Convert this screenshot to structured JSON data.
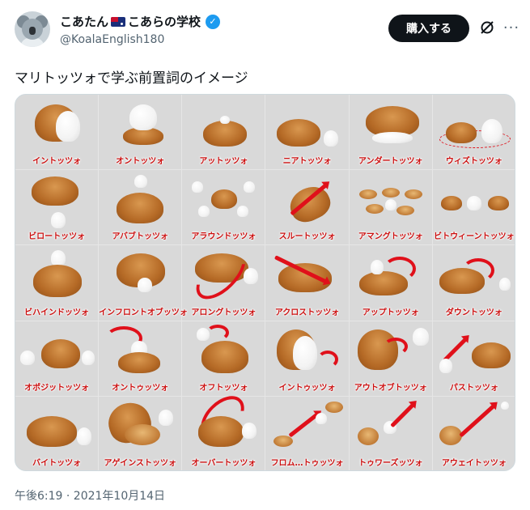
{
  "user": {
    "display_name_pre": "こあたん",
    "display_name_post": "こあらの学校",
    "handle": "@KoalaEnglish180",
    "verified": true,
    "flag_icon": "australia-flag-icon"
  },
  "actions": {
    "buy_label": "購入する",
    "grok_icon": "grok-icon",
    "more_icon": "more-icon"
  },
  "tweet": {
    "text": "マリトッツォで学ぶ前置詞のイメージ",
    "timestamp": "午後6:19 · 2021年10月14日"
  },
  "image": {
    "cells": [
      {
        "label": "イントッツォ"
      },
      {
        "label": "オントッツォ"
      },
      {
        "label": "アットッツォ"
      },
      {
        "label": "ニアトッツォ"
      },
      {
        "label": "アンダートッツォ"
      },
      {
        "label": "ウィズトッツォ"
      },
      {
        "label": "ビロートッツォ"
      },
      {
        "label": "アバブトッツォ"
      },
      {
        "label": "アラウンドッツォ"
      },
      {
        "label": "スルートッツォ"
      },
      {
        "label": "アマングトッツォ"
      },
      {
        "label": "ビトウィーントッツォ"
      },
      {
        "label": "ビハインドッツォ"
      },
      {
        "label": "インフロントオブッツォ"
      },
      {
        "label": "アロングトッツォ"
      },
      {
        "label": "アクロストッツォ"
      },
      {
        "label": "アップトッツォ"
      },
      {
        "label": "ダウントッツォ"
      },
      {
        "label": "オポジットッツォ"
      },
      {
        "label": "オントゥッツォ"
      },
      {
        "label": "オフトッツォ"
      },
      {
        "label": "イントゥッツォ"
      },
      {
        "label": "アウトオブトッツォ"
      },
      {
        "label": "パストッツォ"
      },
      {
        "label": "バイトッツォ"
      },
      {
        "label": "アゲインストッツォ"
      },
      {
        "label": "オーバートッツォ"
      },
      {
        "label": "フロム…トゥッツォ"
      },
      {
        "label": "トゥワーズッツォ"
      },
      {
        "label": "アウェイトッツォ"
      }
    ]
  }
}
